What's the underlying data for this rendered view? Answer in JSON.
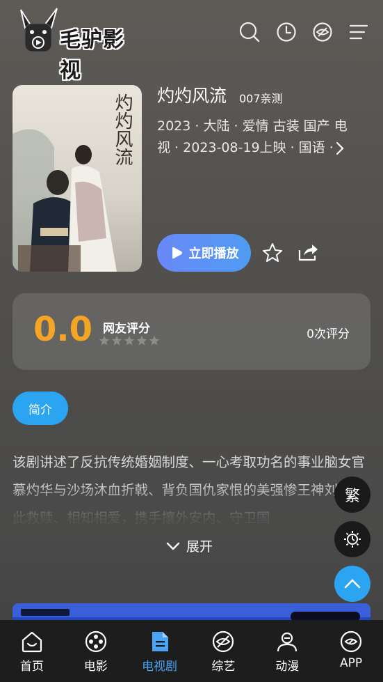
{
  "app": {
    "logo_text": "毛驴影视"
  },
  "header": {
    "icons": [
      "search-icon",
      "history-icon",
      "eye-off-icon",
      "menu-icon"
    ]
  },
  "movie": {
    "title": "灼灼风流",
    "source": "007亲测",
    "meta_line1": "2023 · 大陆 · 爱情 古装 国产 电",
    "meta_line2": "视  · 2023-08-19上映 · 国语 · ",
    "poster_text": "灼灼风流",
    "play_label": "立即播放"
  },
  "rating": {
    "score": "0.0",
    "label": "网友评分",
    "stars": 0,
    "count_text": "0次评分"
  },
  "tabs": {
    "intro": "简介"
  },
  "description": {
    "text": "该剧讲述了反抗传统婚姻制度、一心考取功名的事业脑女官慕灼华与沙场沐血折戟、背负国仇家恨的美强惨王神刘衍彼此救赎、相知相爱，携手攘外安内、守卫国",
    "expand_label": "展开"
  },
  "float_buttons": {
    "traditional_label": "繁"
  },
  "bottom_nav": [
    {
      "label": "首页",
      "icon": "home-icon"
    },
    {
      "label": "电影",
      "icon": "film-reel-icon"
    },
    {
      "label": "电视剧",
      "icon": "document-icon",
      "active": true
    },
    {
      "label": "综艺",
      "icon": "eye-off-icon"
    },
    {
      "label": "动漫",
      "icon": "user-icon"
    },
    {
      "label": "APP",
      "icon": "compass-icon"
    }
  ],
  "colors": {
    "accent": "#2ba4f1",
    "score": "#f5a524",
    "active_nav": "#4aa3f5",
    "play_gradient_start": "#6a88f8",
    "play_gradient_end": "#4f9cf2"
  }
}
